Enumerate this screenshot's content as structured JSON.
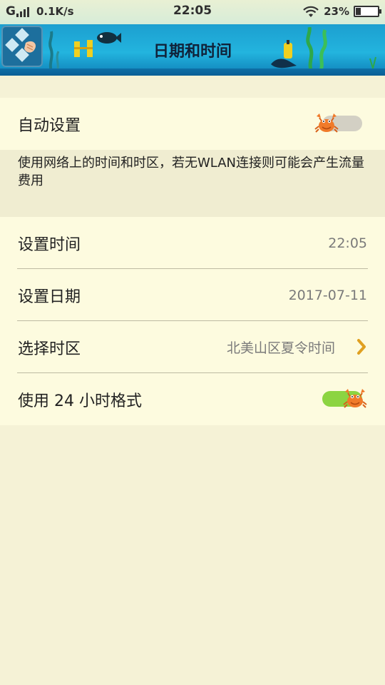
{
  "status_bar": {
    "network": "G",
    "speed": "0.1K/s",
    "time": "22:05",
    "battery_percent": "23%",
    "battery_level": 0.23
  },
  "header": {
    "title": "日期和时间"
  },
  "settings": {
    "auto_set": {
      "label": "自动设置",
      "enabled": false
    },
    "auto_set_description": "使用网络上的时间和时区，若无WLAN连接则可能会产生流量费用",
    "set_time": {
      "label": "设置时间",
      "value": "22:05"
    },
    "set_date": {
      "label": "设置日期",
      "value": "2017-07-11"
    },
    "time_zone": {
      "label": "选择时区",
      "value": "北美山区夏令时间"
    },
    "use_24h": {
      "label": "使用 24 小时格式",
      "enabled": true
    }
  },
  "colors": {
    "header_blue": "#1c9fd0",
    "background": "#f5f2d6",
    "row_background": "#fdfbdf",
    "toggle_on": "#8cd442",
    "toggle_off": "#d3d0c4",
    "crab": "#f07a2a",
    "arrow": "#e0a020"
  },
  "icons": {
    "back": "diamond-grid-icon",
    "wifi": "wifi-icon",
    "battery": "battery-icon",
    "toggle_knob": "crab-icon",
    "chevron": "chevron-right-icon"
  }
}
